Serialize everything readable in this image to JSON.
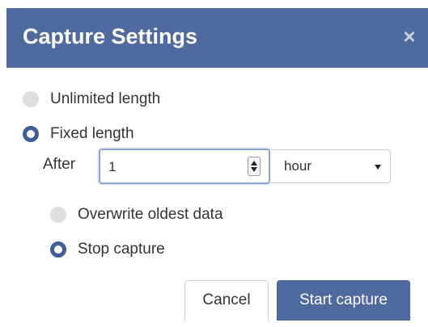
{
  "dialog": {
    "title": "Capture Settings",
    "close_glyph": "×"
  },
  "options": {
    "unlimited_label": "Unlimited length",
    "fixed_label": "Fixed length",
    "selected": "Fixed length"
  },
  "duration": {
    "after_label": "After",
    "value": "1",
    "unit": "hour"
  },
  "on_limit": {
    "overwrite_label": "Overwrite oldest data",
    "stop_label": "Stop capture",
    "selected": "Stop capture"
  },
  "buttons": {
    "cancel_label": "Cancel",
    "start_label": "Start capture"
  },
  "colors": {
    "header": "#4f6a9e",
    "radio_selected": "#3d5e98",
    "radio_unselected": "#dedede",
    "primary_button": "#4f6a9e"
  },
  "icons": {
    "close": "close-icon",
    "stepper": "spinner-arrows-icon",
    "dropdown": "chevron-down-icon"
  }
}
